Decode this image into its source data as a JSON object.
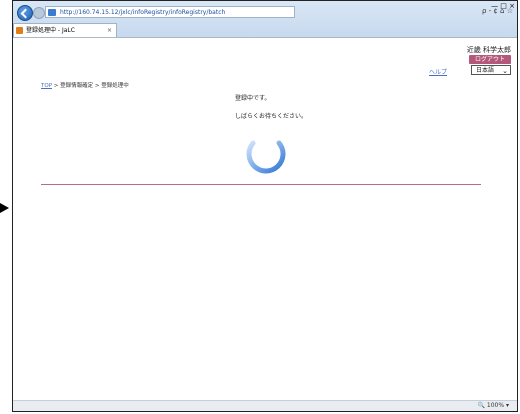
{
  "browser": {
    "address": "http://160.74.15.12/jxlc/infoRegistry/infoRegistry/batch",
    "address_host": "160.74.15.12",
    "tab_title": "登録処理中 - JaLC",
    "tab_close": "×",
    "toolbar_right": "ρ - ¢  ⌂ ☆",
    "window_controls": "— □ ×",
    "zoom": "🔍 100%  ▾"
  },
  "header": {
    "user_name": "近畿 科学太郎",
    "logout_label": "ログアウト",
    "help_label": "ヘルプ",
    "language_selected": "日本語"
  },
  "breadcrumb": {
    "top": "TOP",
    "sep": " > ",
    "item2": "登録情報確定",
    "item3": "登録処理中"
  },
  "main": {
    "message_1": "登録中です。",
    "message_2": "しばらくお待ちください。"
  },
  "colors": {
    "accent": "#b4587a",
    "link": "#4b6fc2",
    "spinner": "#2f76d6"
  }
}
